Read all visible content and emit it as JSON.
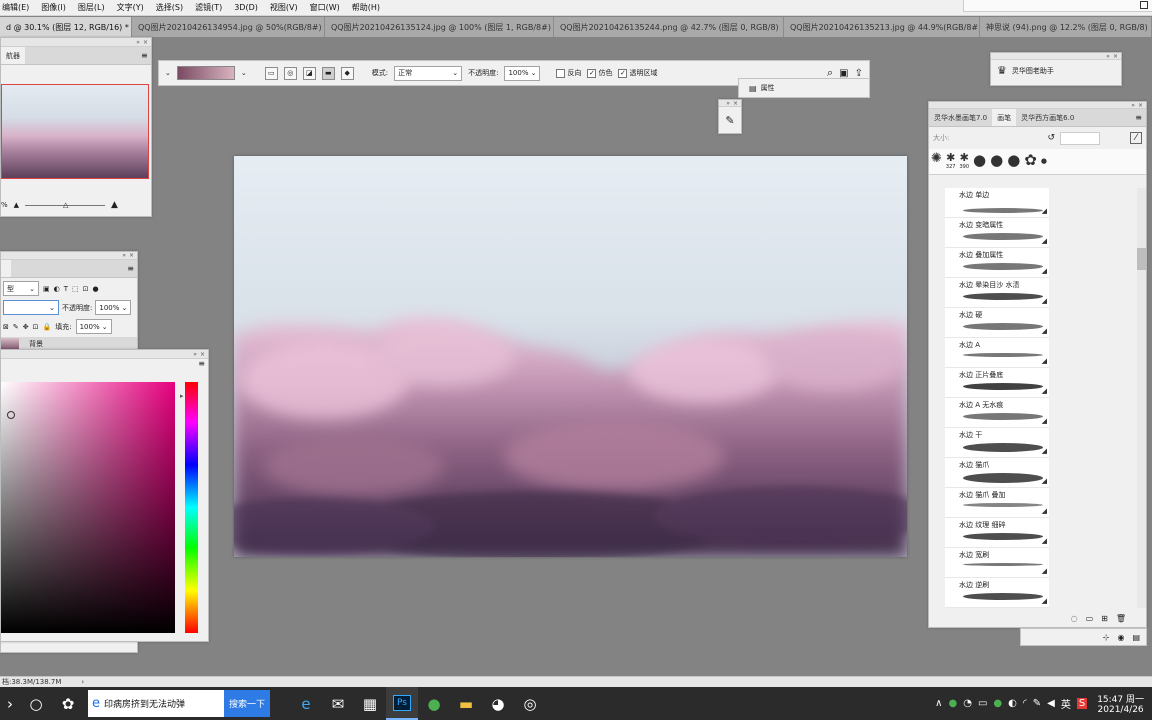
{
  "menubar": [
    "编辑(E)",
    "图像(I)",
    "图层(L)",
    "文字(Y)",
    "选择(S)",
    "滤镜(T)",
    "3D(D)",
    "视图(V)",
    "窗口(W)",
    "帮助(H)"
  ],
  "tabs": [
    {
      "label": "d @ 30.1% (图层 12, RGB/16) *",
      "active": true
    },
    {
      "label": "QQ图片20210426134954.jpg @ 50%(RGB/8#)",
      "active": false
    },
    {
      "label": "QQ图片20210426135124.jpg @ 100% (图层 1, RGB/8#) *",
      "active": false
    },
    {
      "label": "QQ图片20210426135244.png @ 42.7% (图层 0, RGB/8)",
      "active": false
    },
    {
      "label": "QQ图片20210426135213.jpg @ 44.9%(RGB/8#)",
      "active": false
    },
    {
      "label": "神思说 (94).png @ 12.2% (图层 0, RGB/8)",
      "active": false
    }
  ],
  "navigator": {
    "tab_label": "航器",
    "zoom": "%"
  },
  "tool_options": {
    "mode_label": "模式:",
    "mode_value": "正常",
    "opacity_label": "不透明度:",
    "opacity_value": "100%",
    "reverse_label": "反向",
    "dither_label": "仿色",
    "transparency_label": "透明区域"
  },
  "properties_label": "属性",
  "plugin_label": "灵华图老助手",
  "layers": {
    "kind_value": "型",
    "opacity_label": "不透明度:",
    "opacity_value": "100%",
    "fill_label": "填充:",
    "fill_value": "100%",
    "layer_name": "背景"
  },
  "brushes_panel": {
    "tabs": [
      "灵华水墨画笔7.0",
      "画笔",
      "灵华西方画笔6.0"
    ],
    "size_label": "大小:",
    "preset_counts": [
      "327",
      "390"
    ],
    "items": [
      "水边 单边",
      "水边 变暗属性",
      "水边 叠加属性",
      "水边 晕染目沙 水渍",
      "水边 硬",
      "水边 A",
      "水边 正片叠底",
      "水边 A 无水痕",
      "水边 干",
      "水边 猫爪",
      "水边 猫爪 叠加",
      "水边 纹理 细碎",
      "水边 宽刷",
      "水边 逆刷"
    ]
  },
  "statusbar": {
    "doc_info": "档:38.3M/138.7M"
  },
  "taskbar": {
    "search_text": "印病房挤到无法动弹",
    "search_button": "搜索一下",
    "time": "15:47 周一",
    "date": "2021/4/26",
    "ime": "英"
  },
  "colors": {
    "fg_swatch_from": "#7a4a63",
    "fg_swatch_to": "#d8b4bf",
    "picker_hue": "#e6007e"
  }
}
